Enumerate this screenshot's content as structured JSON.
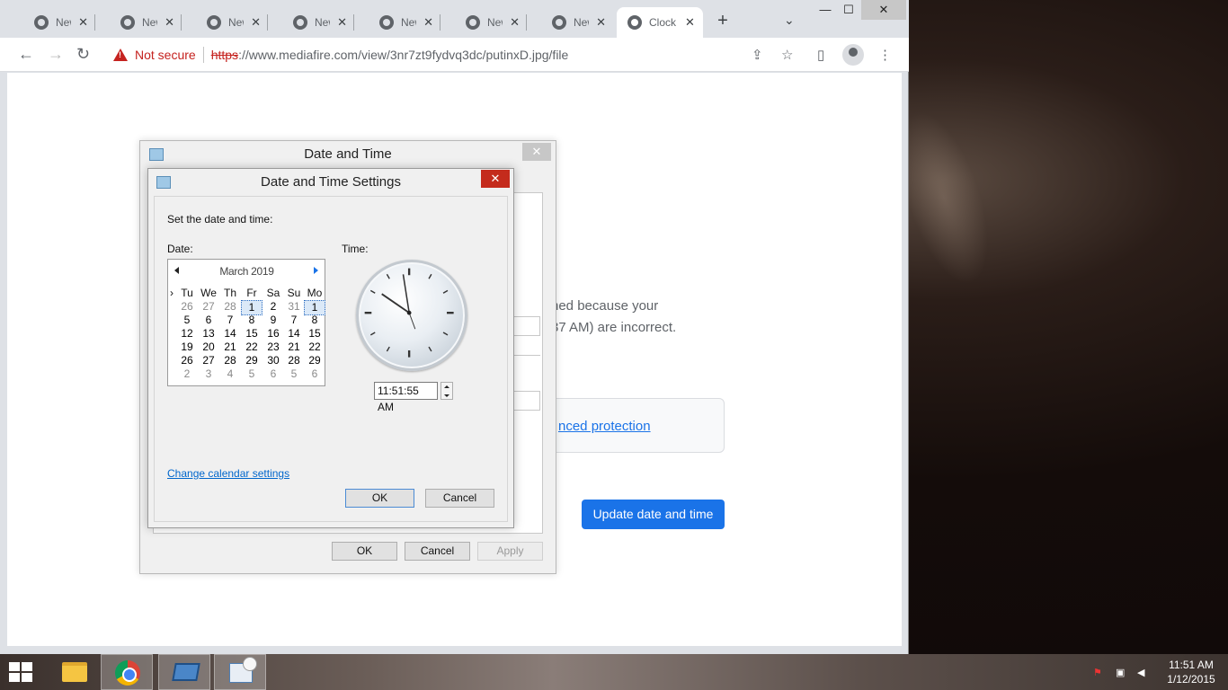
{
  "browser": {
    "tabs": [
      {
        "label": "New T"
      },
      {
        "label": "New T"
      },
      {
        "label": "New T"
      },
      {
        "label": "New T"
      },
      {
        "label": "New T"
      },
      {
        "label": "New T"
      },
      {
        "label": "New T"
      },
      {
        "label": "Clock"
      }
    ],
    "tab_close": "✕",
    "new_tab": "+",
    "tab_search": "⌄",
    "window": {
      "minimize": "—",
      "maximize": "☐",
      "close": "✕"
    },
    "nav": {
      "back": "←",
      "forward": "→",
      "reload": "↻"
    },
    "address": {
      "security_label": "Not secure",
      "url_scheme": "https",
      "url_rest": "://www.mediafire.com/view/3nr7zt9fydvq3dc/putinxD.jpg/file"
    },
    "toolbar_icons": {
      "share": "⇪",
      "bookmark": "☆",
      "sidepanel": "▯",
      "menu": "⋮"
    }
  },
  "page": {
    "message_line1": "ned because your",
    "message_line2": "37 AM) are incorrect.",
    "protection_link": "nced protection",
    "update_button": "Update date and time"
  },
  "outer_dialog": {
    "title": "Date and Time",
    "close": "✕",
    "ok": "OK",
    "cancel": "Cancel",
    "apply": "Apply"
  },
  "inner_dialog": {
    "title": "Date and Time Settings",
    "close": "✕",
    "instruction": "Set the date and time:",
    "date_label": "Date:",
    "time_label": "Time:",
    "calendar": {
      "month": "March 2019",
      "weekdays": [
        "Tu",
        "We",
        "Th",
        "Fr",
        "Sa",
        "Su",
        "Mo"
      ],
      "weeks": [
        [
          "26",
          "27",
          "28",
          "1",
          "2",
          "31",
          "1"
        ],
        [
          "5",
          "6",
          "7",
          "8",
          "9",
          "7",
          "8"
        ],
        [
          "12",
          "13",
          "14",
          "15",
          "16",
          "14",
          "15"
        ],
        [
          "19",
          "20",
          "21",
          "22",
          "23",
          "21",
          "22"
        ],
        [
          "26",
          "27",
          "28",
          "29",
          "30",
          "28",
          "29"
        ],
        [
          "2",
          "3",
          "4",
          "5",
          "6",
          "5",
          "6"
        ]
      ]
    },
    "time_value": "11:51:55 AM",
    "calendar_settings_link": "Change calendar settings",
    "ok": "OK",
    "cancel": "Cancel"
  },
  "taskbar": {
    "time": "11:51 AM",
    "date": "1/12/2015"
  }
}
